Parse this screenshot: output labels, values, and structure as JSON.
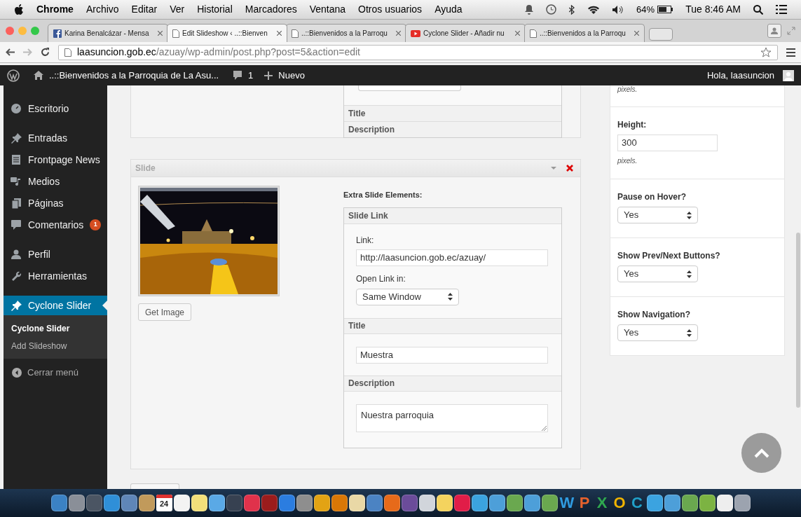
{
  "menubar": {
    "app": "Chrome",
    "menus": [
      "Archivo",
      "Editar",
      "Ver",
      "Historial",
      "Marcadores",
      "Ventana",
      "Otros usuarios",
      "Ayuda"
    ],
    "battery": "64%",
    "clock": "Tue 8:46 AM"
  },
  "tabs": [
    {
      "title": "Karina Benalcázar - Mensa",
      "kind": "facebook",
      "selected": false
    },
    {
      "title": "Edit Slideshow ‹ ..::Bienven",
      "kind": "page",
      "selected": true
    },
    {
      "title": "..::Bienvenidos a la Parroqu",
      "kind": "page",
      "selected": false
    },
    {
      "title": "Cyclone Slider - Añadir nu",
      "kind": "youtube",
      "selected": false
    },
    {
      "title": "..::Bienvenidos a la Parroqu",
      "kind": "page",
      "selected": false
    }
  ],
  "address": {
    "host": "laasuncion.gob.ec",
    "path": "/azuay/wp-admin/post.php?post=5&action=edit"
  },
  "adminbar": {
    "site": "..::Bienvenidos a la Parroquia de La Asu...",
    "comments": "1",
    "new": "Nuevo",
    "greeting": "Hola, laasuncion"
  },
  "sidebar": {
    "items": [
      {
        "label": "Escritorio",
        "kind": "dashboard",
        "selected": false
      },
      {
        "label": "Entradas",
        "kind": "pin",
        "selected": false
      },
      {
        "label": "Frontpage News",
        "kind": "doc",
        "selected": false
      },
      {
        "label": "Medios",
        "kind": "media",
        "selected": false
      },
      {
        "label": "Páginas",
        "kind": "pages",
        "selected": false
      },
      {
        "label": "Comentarios",
        "kind": "comment",
        "selected": false,
        "badge": "1"
      },
      {
        "label": "Perfil",
        "kind": "user",
        "selected": false
      },
      {
        "label": "Herramientas",
        "kind": "wrench",
        "selected": false
      },
      {
        "label": "Cyclone Slider",
        "kind": "pin",
        "selected": true
      }
    ],
    "submenu": [
      {
        "label": "Cyclone Slider",
        "selected": true
      },
      {
        "label": "Add Slideshow",
        "selected": false
      }
    ],
    "collapse": "Cerrar menú"
  },
  "prev_slide": {
    "sections": [
      "Title",
      "Description"
    ]
  },
  "slide": {
    "header": "Slide",
    "get_image": "Get Image",
    "extra_heading": "Extra Slide Elements:",
    "link_section": "Slide Link",
    "link_label": "Link:",
    "link_value": "http://laasuncion.gob.ec/azuay/",
    "open_label": "Open Link in:",
    "open_value": "Same Window",
    "title_section": "Title",
    "title_value": "Muestra",
    "description_section": "Description",
    "description_value": "Nuestra parroquia"
  },
  "settings": {
    "width_unit": "pixels.",
    "height_label": "Height:",
    "height_value": "300",
    "height_unit": "pixels.",
    "selects": [
      {
        "label": "Pause on Hover?",
        "value": "Yes"
      },
      {
        "label": "Show Prev/Next Buttons?",
        "value": "Yes"
      },
      {
        "label": "Show Navigation?",
        "value": "Yes"
      }
    ]
  },
  "dock": [
    {
      "kind": "app",
      "color": "#3b82c4"
    },
    {
      "kind": "app",
      "color": "#8a8f98"
    },
    {
      "kind": "app",
      "color": "#4b5563"
    },
    {
      "kind": "app",
      "color": "#2f8fd8"
    },
    {
      "kind": "app",
      "color": "#5f86b8"
    },
    {
      "kind": "app",
      "color": "#c19a5b"
    },
    {
      "kind": "calendar",
      "day": "24",
      "color": "#ffffff"
    },
    {
      "kind": "app",
      "color": "#f3f3f3"
    },
    {
      "kind": "app",
      "color": "#f2df7a"
    },
    {
      "kind": "app",
      "color": "#5aa9e6"
    },
    {
      "kind": "app",
      "color": "#374151"
    },
    {
      "kind": "app",
      "color": "#e0324b"
    },
    {
      "kind": "app",
      "color": "#9b1c1c"
    },
    {
      "kind": "app",
      "color": "#2b7de0"
    },
    {
      "kind": "app",
      "color": "#8e8e8e"
    },
    {
      "kind": "app",
      "color": "#e2a314"
    },
    {
      "kind": "app",
      "color": "#d97706"
    },
    {
      "kind": "app",
      "color": "#e9d8a6"
    },
    {
      "kind": "app",
      "color": "#4b83c3"
    },
    {
      "kind": "app",
      "color": "#e66a1a"
    },
    {
      "kind": "app",
      "color": "#6b4c9a"
    },
    {
      "kind": "app",
      "color": "#d1d5db"
    },
    {
      "kind": "app",
      "color": "#f4d35e"
    },
    {
      "kind": "app",
      "color": "#e11d48"
    },
    {
      "kind": "app",
      "color": "#3ba3e0"
    },
    {
      "kind": "app",
      "color": "#4d9fd9"
    },
    {
      "kind": "app",
      "color": "#6aa84f"
    },
    {
      "kind": "app",
      "color": "#4d9fd9"
    },
    {
      "kind": "app",
      "color": "#6aa84f"
    },
    {
      "kind": "letter",
      "glyph": "W",
      "color": "#2f9be0"
    },
    {
      "kind": "letter",
      "glyph": "P",
      "color": "#e8622c"
    },
    {
      "kind": "letter",
      "glyph": "X",
      "color": "#2fa84f"
    },
    {
      "kind": "letter",
      "glyph": "O",
      "color": "#f0b400"
    },
    {
      "kind": "letter",
      "glyph": "C",
      "color": "#20a0c8"
    },
    {
      "kind": "app",
      "color": "#3ba3e0"
    },
    {
      "kind": "app",
      "color": "#4d9fd9"
    },
    {
      "kind": "app",
      "color": "#6aa84f"
    },
    {
      "kind": "app",
      "color": "#7cb342"
    },
    {
      "kind": "app",
      "color": "#eeeeee"
    },
    {
      "kind": "app",
      "color": "#9ca3af"
    }
  ]
}
